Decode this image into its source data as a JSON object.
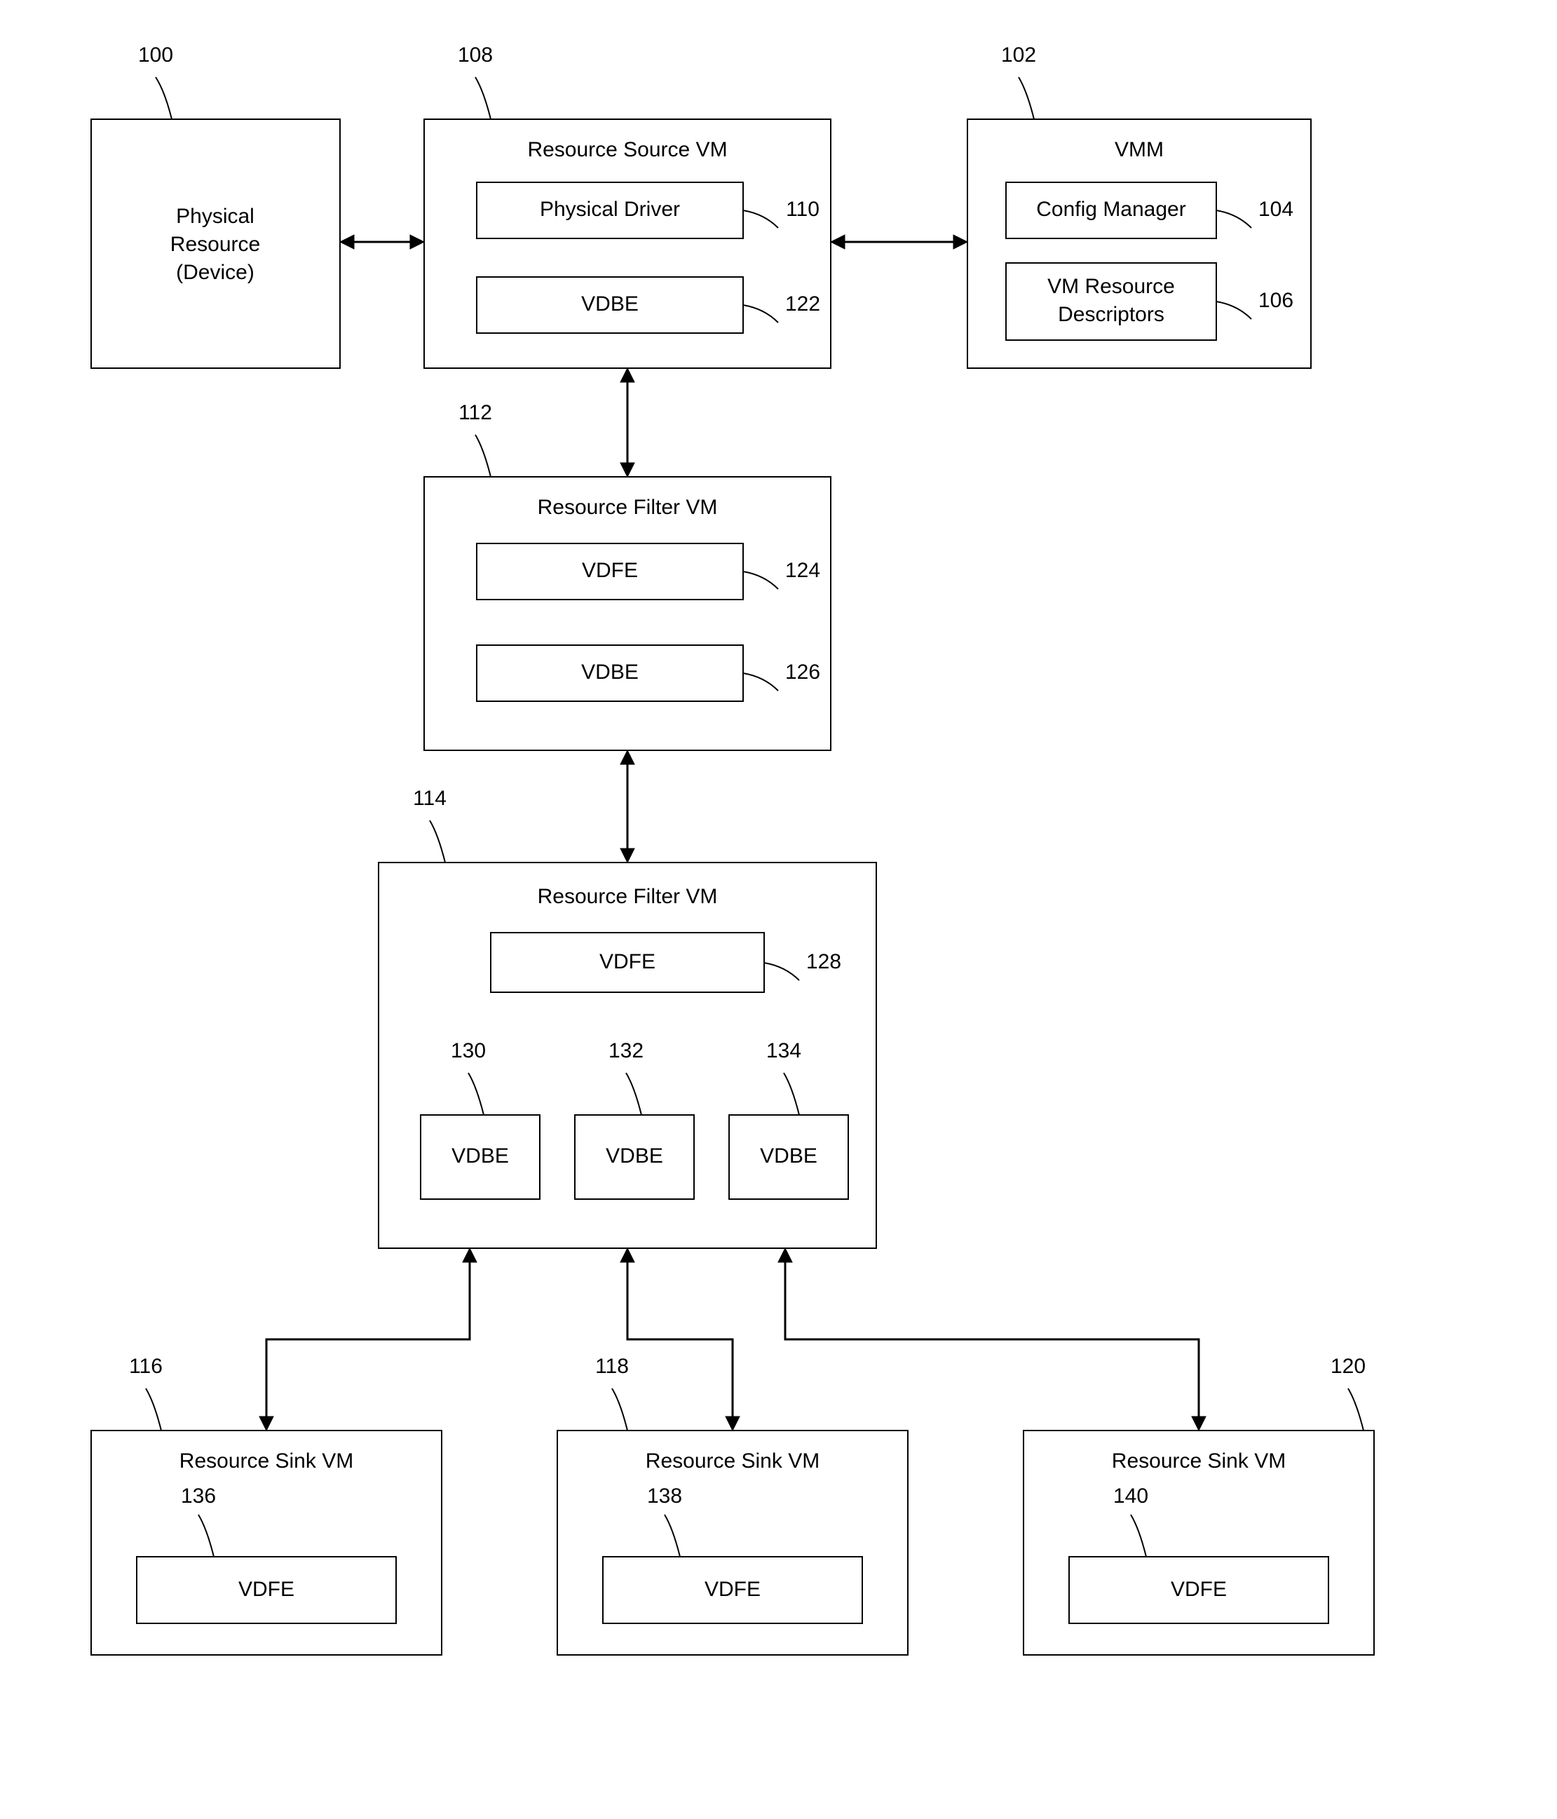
{
  "blocks": {
    "physical_resource": {
      "ref": "100",
      "line1": "Physical",
      "line2": "Resource",
      "line3": "(Device)"
    },
    "source_vm": {
      "ref": "108",
      "title": "Resource Source VM",
      "physical_driver": {
        "ref": "110",
        "label": "Physical Driver"
      },
      "vdbe": {
        "ref": "122",
        "label": "VDBE"
      }
    },
    "vmm": {
      "ref": "102",
      "title": "VMM",
      "config_manager": {
        "ref": "104",
        "label": "Config Manager"
      },
      "vm_res_desc": {
        "ref": "106",
        "line1": "VM Resource",
        "line2": "Descriptors"
      }
    },
    "filter_vm_1": {
      "ref": "112",
      "title": "Resource Filter VM",
      "vdfe": {
        "ref": "124",
        "label": "VDFE"
      },
      "vdbe": {
        "ref": "126",
        "label": "VDBE"
      }
    },
    "filter_vm_2": {
      "ref": "114",
      "title": "Resource Filter VM",
      "vdfe": {
        "ref": "128",
        "label": "VDFE"
      },
      "vdbe1": {
        "ref": "130",
        "label": "VDBE"
      },
      "vdbe2": {
        "ref": "132",
        "label": "VDBE"
      },
      "vdbe3": {
        "ref": "134",
        "label": "VDBE"
      }
    },
    "sink_vm_1": {
      "ref": "116",
      "title": "Resource Sink VM",
      "vdfe": {
        "ref": "136",
        "label": "VDFE"
      }
    },
    "sink_vm_2": {
      "ref": "118",
      "title": "Resource Sink VM",
      "vdfe": {
        "ref": "138",
        "label": "VDFE"
      }
    },
    "sink_vm_3": {
      "ref": "120",
      "title": "Resource Sink VM",
      "vdfe": {
        "ref": "140",
        "label": "VDFE"
      }
    }
  }
}
